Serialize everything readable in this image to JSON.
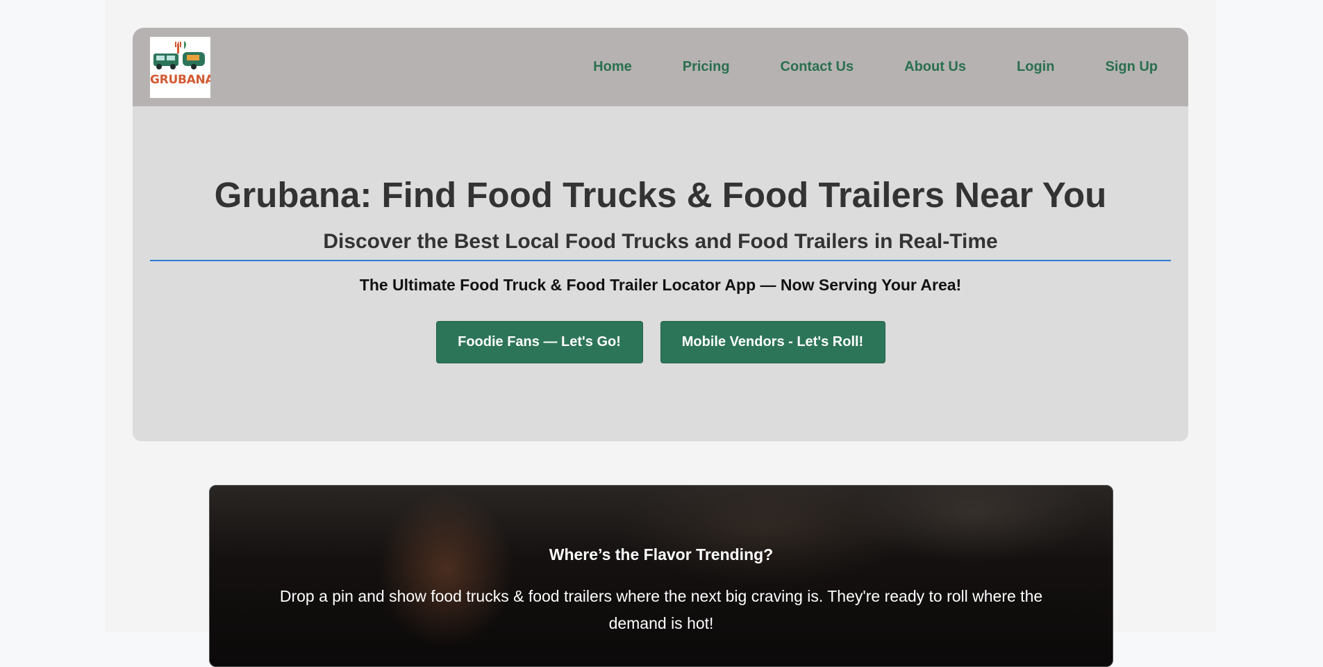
{
  "brand": {
    "logo_text": "GRUBANA"
  },
  "nav": {
    "items": [
      {
        "label": "Home"
      },
      {
        "label": "Pricing"
      },
      {
        "label": "Contact Us"
      },
      {
        "label": "About Us"
      },
      {
        "label": "Login"
      },
      {
        "label": "Sign Up"
      }
    ]
  },
  "hero": {
    "title": "Grubana: Find Food Trucks & Food Trailers Near You",
    "subtitle": "Discover the Best Local Food Trucks and Food Trailers in Real-Time",
    "tagline": "The Ultimate Food Truck & Food Trailer Locator App — Now Serving Your Area!",
    "buttons": {
      "fans": "Foodie Fans — Let's Go!",
      "vendors": "Mobile Vendors - Let's Roll!"
    }
  },
  "trending": {
    "title": "Where’s the Flavor Trending?",
    "text": "Drop a pin and show food trucks & food trailers where the next big craving is. They're ready to roll where the demand is hot!"
  },
  "colors": {
    "accent": "#2d7559",
    "nav_link": "#2a6f4f",
    "navbar_bg": "#b6b2b1",
    "hero_bg": "#dcdcdc",
    "rule": "#2b7bd6",
    "logo_text": "#d35a33"
  }
}
